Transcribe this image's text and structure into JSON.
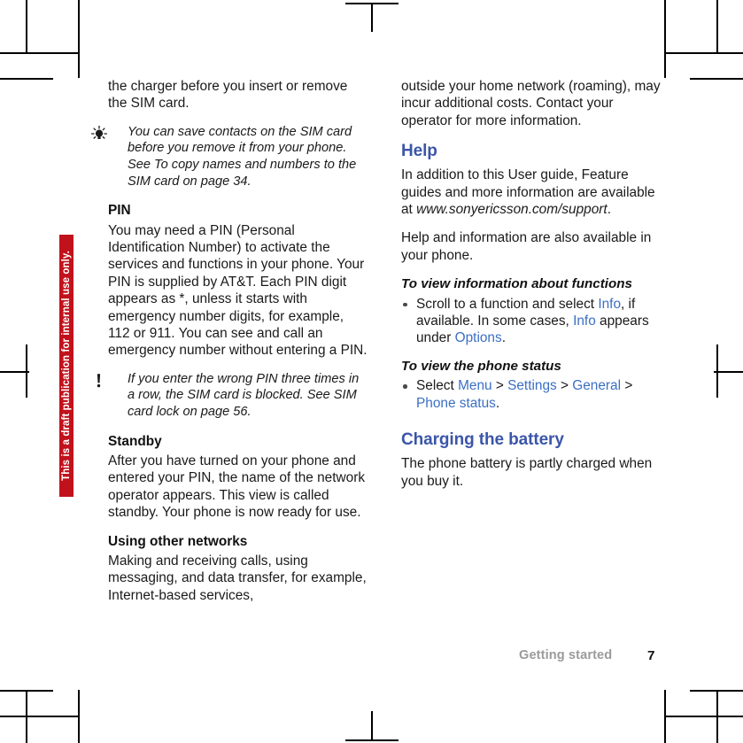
{
  "document": {
    "watermark": "This is a draft publication for internal use only.",
    "footer": {
      "section": "Getting started",
      "page_number": "7"
    },
    "colors": {
      "heading_blue": "#3b55a8",
      "link_blue": "#3b6fc4",
      "watermark_red": "#c1121c",
      "footer_gray": "#9b9b9b",
      "body_black": "#1a1a1a"
    }
  },
  "left_column": {
    "continued_paragraph": "the charger before you insert or remove the SIM card.",
    "tip_callout": {
      "icon": "lightbulb-tip-icon",
      "text": "You can save contacts on the SIM card before you remove it from your phone. See To copy names and numbers to the SIM card on page 34."
    },
    "pin_heading": "PIN",
    "pin_paragraph": "You may need a PIN (Personal Identification Number) to activate the services and functions in your phone. Your PIN is supplied by AT&T. Each PIN digit appears as *, unless it starts with emergency number digits, for example, 112 or 911. You can see and call an emergency number without entering a PIN.",
    "warning_callout": {
      "icon": "exclamation-note-icon",
      "text": "If you enter the wrong PIN three times in a row, the SIM card is blocked. See SIM card lock on page 56."
    },
    "standby_heading": "Standby",
    "standby_paragraph": "After you have turned on your phone and entered your PIN, the name of the network operator appears. This view is called standby. Your phone is now ready for use.",
    "other_networks_heading": "Using other networks",
    "other_networks_paragraph": "Making and receiving calls, using messaging, and data transfer, for example, Internet-based services,"
  },
  "right_column": {
    "continued_paragraph": "outside your home network (roaming), may incur additional costs. Contact your operator for more information.",
    "help_heading": "Help",
    "help_paragraph_1_before": "In addition to this User guide, Feature guides and more information are available at ",
    "help_paragraph_1_url": "www.sonyericsson.com/support",
    "help_paragraph_1_after": ".",
    "help_paragraph_2": "Help and information are also available in your phone.",
    "proc_1_heading": "To view information about functions",
    "proc_1_bullet": {
      "part_1": "Scroll to a function and select ",
      "link_1": "Info",
      "part_2": ", if available. In some cases, ",
      "link_2": "Info",
      "part_3": " appears under ",
      "link_3": "Options",
      "part_4": "."
    },
    "proc_2_heading": "To view the phone status",
    "proc_2_bullet": {
      "part_1": "Select ",
      "link_1": "Menu",
      "sep_1": " > ",
      "link_2": "Settings",
      "sep_2": " > ",
      "link_3": "General",
      "sep_3": " > ",
      "link_4": "Phone status",
      "part_end": "."
    },
    "charging_heading": "Charging the battery",
    "charging_paragraph": "The phone battery is partly charged when you buy it."
  }
}
